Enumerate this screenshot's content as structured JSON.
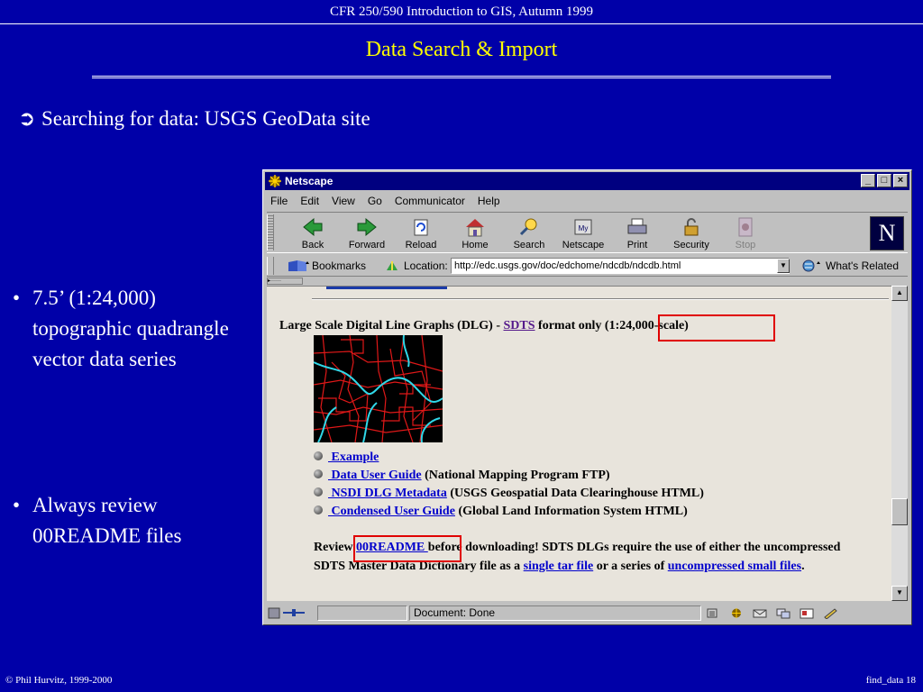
{
  "slide": {
    "header": "CFR 250/590 Introduction to GIS, Autumn 1999",
    "title": "Data Search  & Import",
    "main_bullet": {
      "marker": "➲",
      "text": "Searching for data: USGS GeoData site"
    },
    "side_bullets": [
      {
        "marker": "•",
        "text": "7.5’ (1:24,000) topographic quadrangle vector data series"
      },
      {
        "marker": "•",
        "text": "Always review 00README files"
      }
    ],
    "footer_left": "© Phil Hurvitz, 1999-2000",
    "footer_right": "find_data 18",
    "colors": {
      "background": "#0000a8",
      "title": "#ffff00",
      "text": "#ffffff",
      "highlight_box": "#e00000"
    }
  },
  "browser": {
    "title": "Netscape",
    "window_buttons": {
      "minimize": "_",
      "maximize": "□",
      "close": "×"
    },
    "menu": [
      "File",
      "Edit",
      "View",
      "Go",
      "Communicator",
      "Help"
    ],
    "toolbar": [
      {
        "label": "Back",
        "icon": "back-arrow-icon"
      },
      {
        "label": "Forward",
        "icon": "forward-arrow-icon"
      },
      {
        "label": "Reload",
        "icon": "reload-icon"
      },
      {
        "label": "Home",
        "icon": "home-icon"
      },
      {
        "label": "Search",
        "icon": "search-icon"
      },
      {
        "label": "Netscape",
        "icon": "netscape-icon"
      },
      {
        "label": "Print",
        "icon": "print-icon"
      },
      {
        "label": "Security",
        "icon": "security-lock-icon"
      },
      {
        "label": "Stop",
        "icon": "stop-icon",
        "disabled": true
      }
    ],
    "logo": "N",
    "location_bar": {
      "bookmarks_label": "Bookmarks",
      "location_label": "Location:",
      "url": "http://edc.usgs.gov/doc/edchome/ndcdb/ndcdb.html",
      "whats_related": "What's Related"
    },
    "page": {
      "heading_prefix": "Large Scale Digital Line Graphs (DLG) - ",
      "heading_link": "SDTS",
      "heading_middle": " format only ",
      "heading_scale": "(1:24,000-scale)",
      "links": [
        {
          "link": " Example",
          "desc": ""
        },
        {
          "link": " Data User Guide",
          "desc": " (National Mapping Program FTP)"
        },
        {
          "link": " NSDI DLG Metadata",
          "desc": " (USGS Geospatial Data Clearinghouse HTML)"
        },
        {
          "link": " Condensed User Guide",
          "desc": " (Global Land Information System HTML)"
        }
      ],
      "para_1": "Review ",
      "para_link_readme": "00README ",
      "para_2": "before downloading! SDTS DLGs require the use of either the uncompressed SDTS Master Data Dictionary file as a ",
      "para_link_tar": "single tar file",
      "para_3": " or a series of ",
      "para_link_small": "uncompressed small files",
      "para_4": "."
    },
    "status_text": "Document: Done"
  }
}
